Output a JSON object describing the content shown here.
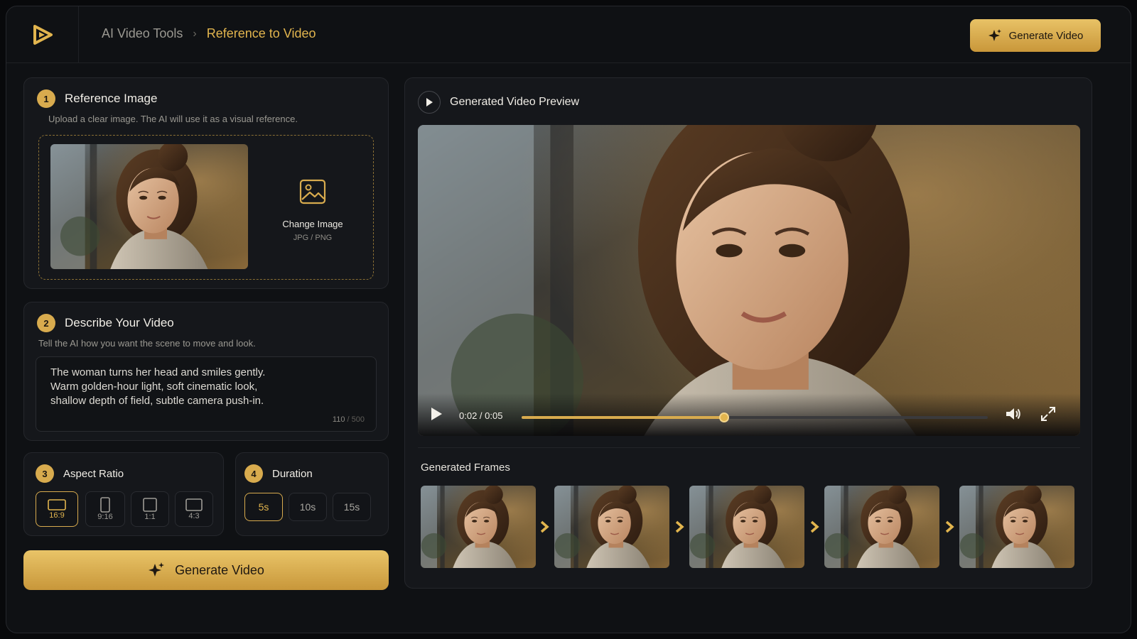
{
  "header": {
    "breadcrumb_root": "AI Video Tools",
    "breadcrumb_separator": "›",
    "breadcrumb_current": "Reference to Video",
    "generate_label": "Generate Video"
  },
  "reference": {
    "step": "1",
    "title": "Reference Image",
    "subtitle": "Upload a clear image. The AI will use it as a visual reference.",
    "change_label": "Change Image",
    "formats": "JPG / PNG"
  },
  "describe": {
    "step": "2",
    "title": "Describe Your Video",
    "subtitle": "Tell the AI how you want the scene to move and look.",
    "prompt_lines": [
      "The woman turns her head and smiles gently.",
      "Warm golden-hour light, soft cinematic look,",
      "shallow depth of field, subtle camera push-in."
    ],
    "char_count": "110",
    "char_limit": "/ 500"
  },
  "aspect": {
    "step": "3",
    "title": "Aspect Ratio",
    "options": [
      "16:9",
      "9:16",
      "1:1",
      "4:3"
    ],
    "selected": "16:9"
  },
  "duration": {
    "step": "4",
    "title": "Duration",
    "options": [
      "5s",
      "10s",
      "15s"
    ],
    "selected": "5s"
  },
  "generate": {
    "label": "Generate Video"
  },
  "preview": {
    "title": "Generated Video Preview",
    "time": "0:02 / 0:05",
    "progress": 0.435,
    "frames_title": "Generated Frames",
    "frame_count": 5
  },
  "colors": {
    "accent": "#d8ab4e",
    "background": "#0f1114",
    "panel": "#15171b"
  },
  "icons": {
    "logo": "play-logo-icon",
    "sparkle": "sparkle-icon",
    "image": "image-icon",
    "play": "play-icon",
    "volume": "volume-icon",
    "fullscreen": "fullscreen-icon",
    "chevron": "chevron-right-icon"
  }
}
